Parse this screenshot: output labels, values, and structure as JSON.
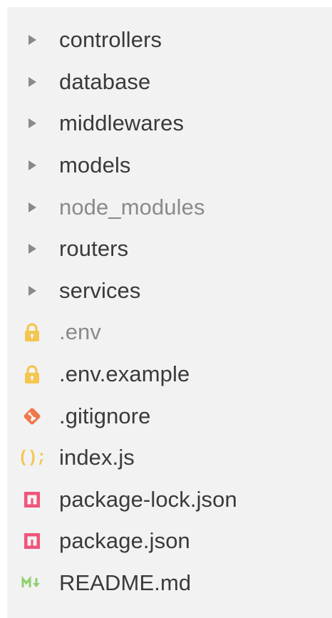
{
  "explorer": {
    "items": [
      {
        "label": "controllers",
        "type": "folder",
        "icon": "chevron-right-icon"
      },
      {
        "label": "database",
        "type": "folder",
        "icon": "chevron-right-icon"
      },
      {
        "label": "middlewares",
        "type": "folder",
        "icon": "chevron-right-icon"
      },
      {
        "label": "models",
        "type": "folder",
        "icon": "chevron-right-icon"
      },
      {
        "label": "node_modules",
        "type": "folder",
        "icon": "chevron-right-icon",
        "dimmed": true
      },
      {
        "label": "routers",
        "type": "folder",
        "icon": "chevron-right-icon"
      },
      {
        "label": "services",
        "type": "folder",
        "icon": "chevron-right-icon"
      },
      {
        "label": ".env",
        "type": "file",
        "icon": "lock-icon",
        "dimmed": true
      },
      {
        "label": ".env.example",
        "type": "file",
        "icon": "lock-icon"
      },
      {
        "label": ".gitignore",
        "type": "file",
        "icon": "git-icon"
      },
      {
        "label": "index.js",
        "type": "file",
        "icon": "javascript-icon",
        "icon_text": "();"
      },
      {
        "label": "package-lock.json",
        "type": "file",
        "icon": "npm-icon"
      },
      {
        "label": "package.json",
        "type": "file",
        "icon": "npm-icon"
      },
      {
        "label": "README.md",
        "type": "file",
        "icon": "markdown-icon"
      }
    ]
  },
  "colors": {
    "panel_bg": "#f2f2f2",
    "text": "#3a3a3a",
    "dimmed_text": "#8a8a8a",
    "chevron": "#8a8a8a",
    "lock": "#f4c64f",
    "git": "#f0784a",
    "javascript": "#f4c64f",
    "npm": "#f0547a",
    "markdown": "#8fd16e"
  }
}
